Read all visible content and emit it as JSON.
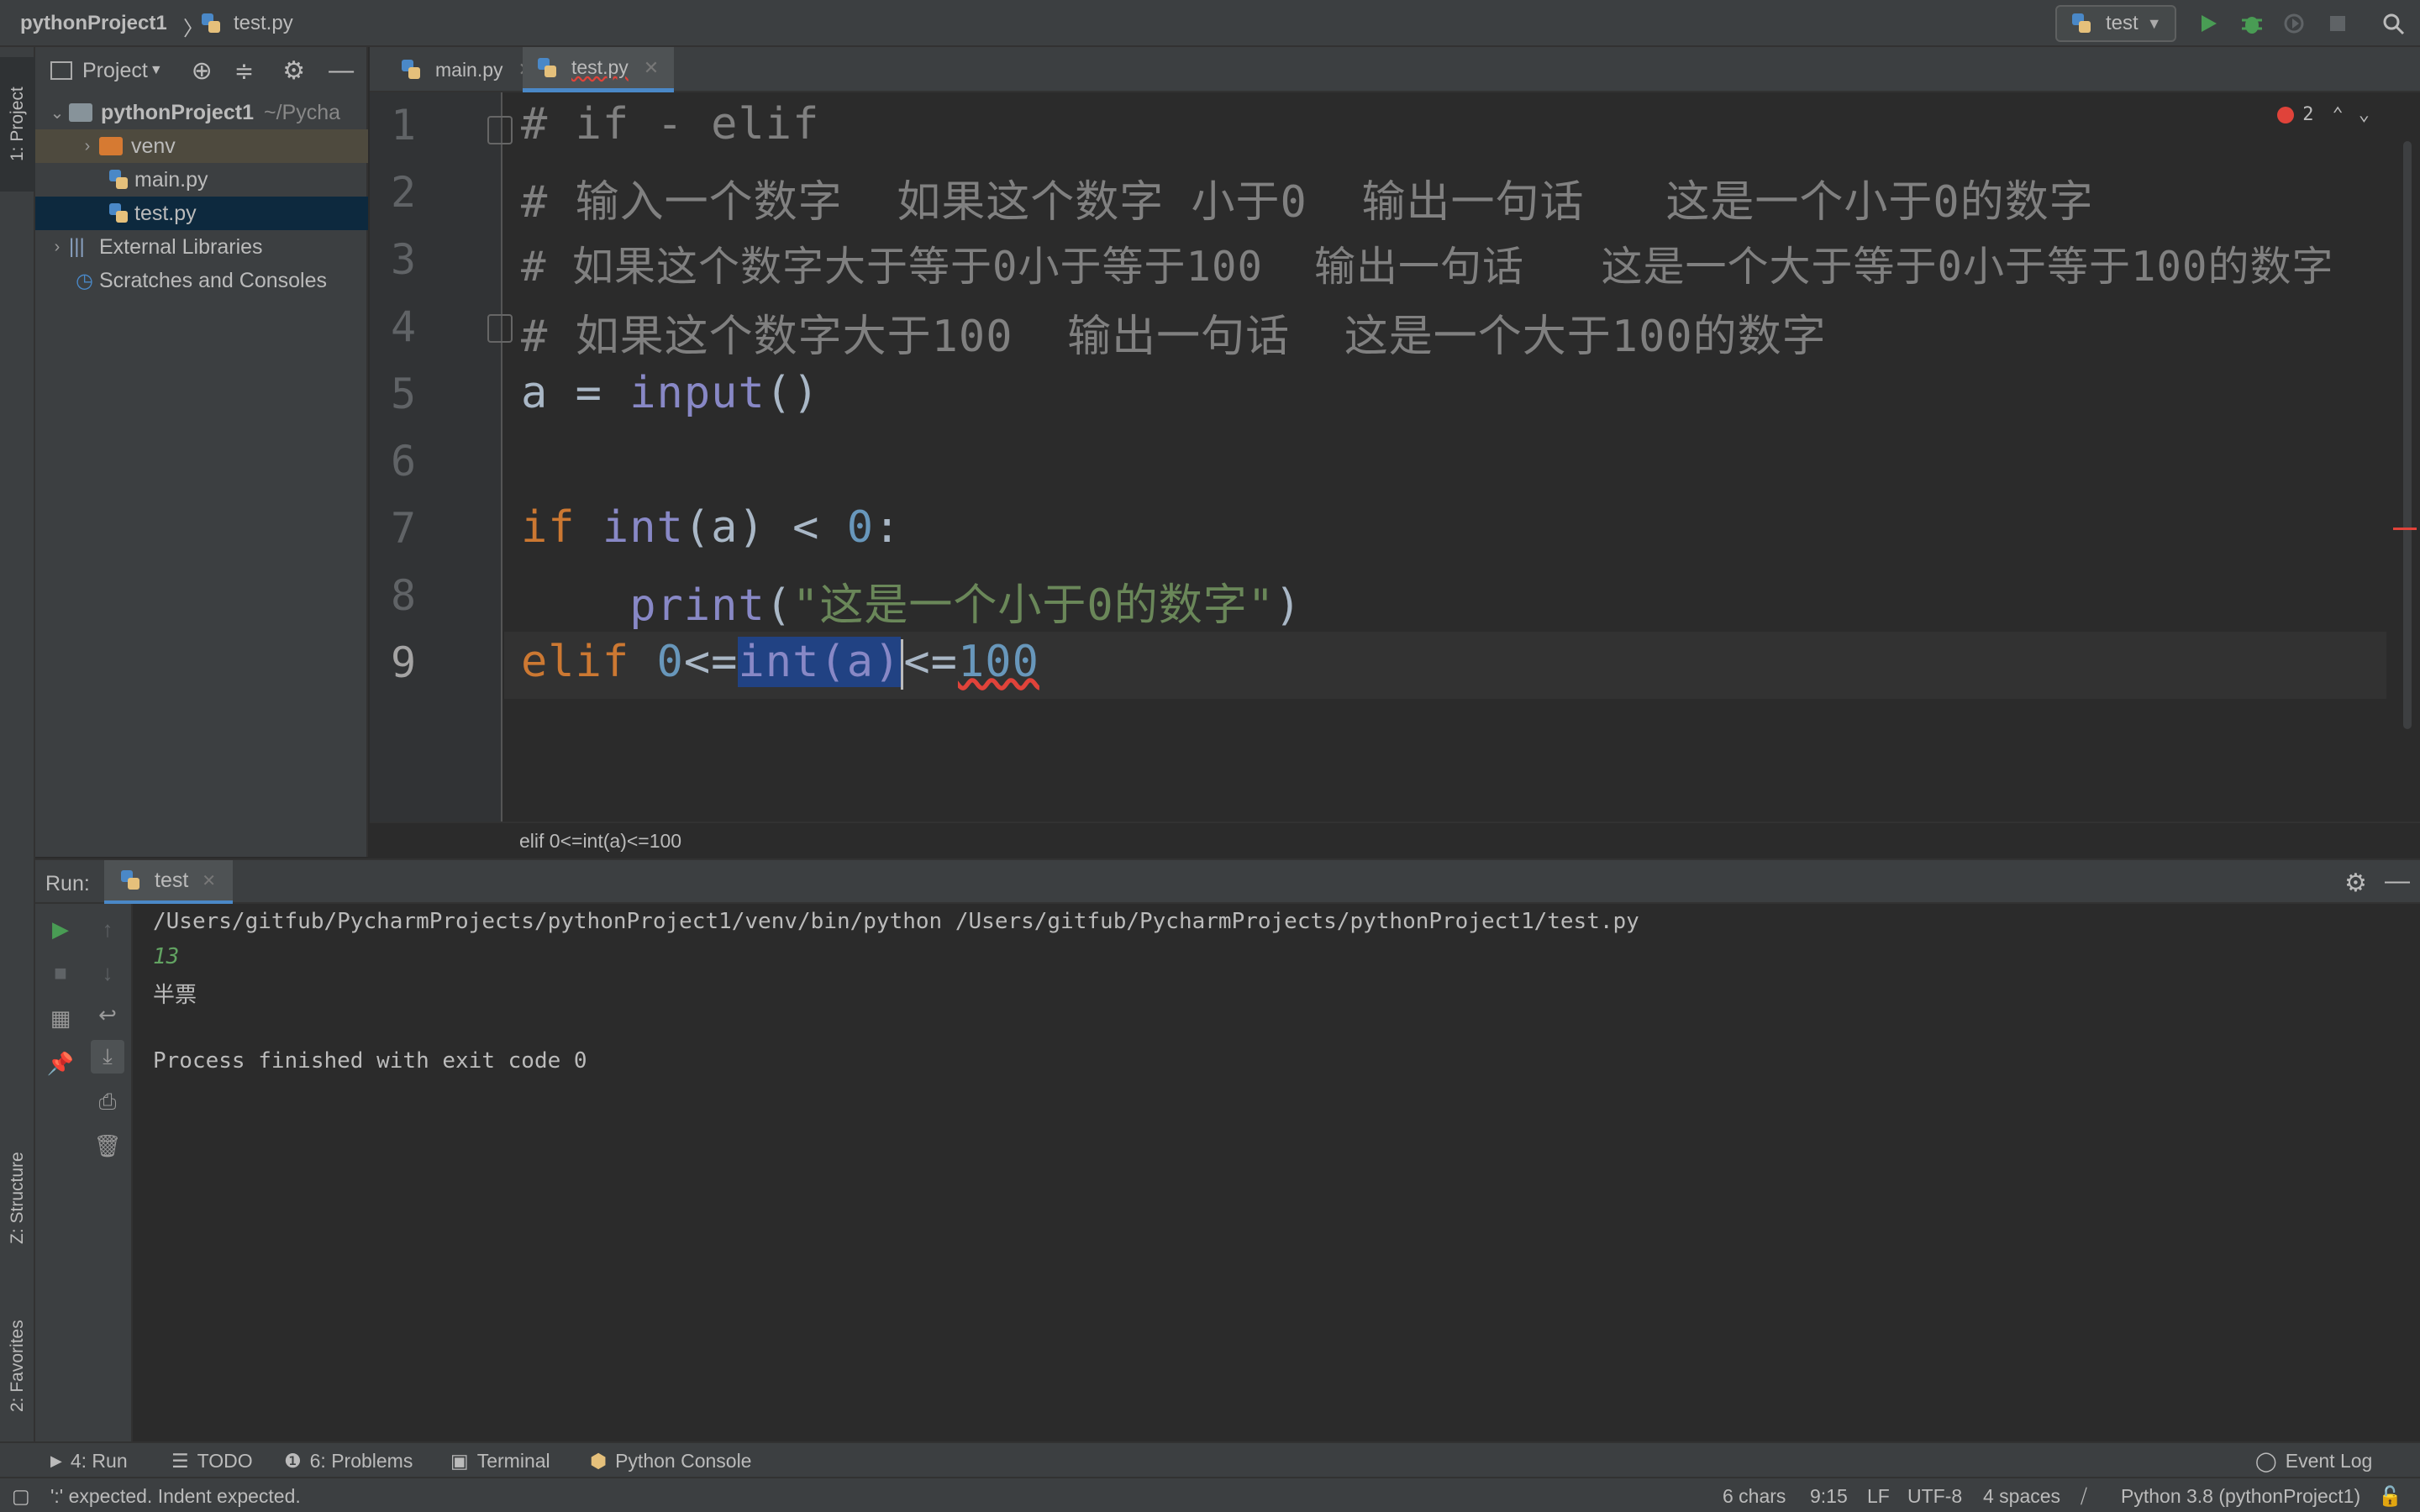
{
  "topbar": {
    "project_name": "pythonProject1",
    "separator": "〉",
    "file_name": "test.py",
    "run_config": "test"
  },
  "left_stripe": {
    "project_tab": "1: Project",
    "structure_tab": "Z: Structure",
    "favorites_tab": "2: Favorites"
  },
  "project_panel": {
    "title": "Project",
    "tree": [
      {
        "label": "pythonProject1",
        "suffix": "~/Pycha"
      },
      {
        "label": "venv"
      },
      {
        "label": "main.py"
      },
      {
        "label": "test.py"
      },
      {
        "label": "External Libraries"
      },
      {
        "label": "Scratches and Consoles"
      }
    ]
  },
  "editor": {
    "tabs": [
      {
        "label": "main.py"
      },
      {
        "label": "test.py"
      }
    ],
    "error_count": "2",
    "line_numbers": [
      "1",
      "2",
      "3",
      "4",
      "5",
      "6",
      "7",
      "8",
      "9"
    ],
    "lines": {
      "l1": "# if - elif",
      "l2": "# 输入一个数字  如果这个数字 小于0  输出一句话   这是一个小于0的数字",
      "l3": "# 如果这个数字大于等于0小于等于100  输出一句话   这是一个大于等于0小于等于100的数字",
      "l4": "# 如果这个数字大于100  输出一句话  这是一个大于100的数字",
      "l5_a": "a = ",
      "l5_fn": "input",
      "l5_p": "()",
      "l7_if": "if ",
      "l7_fn": "int",
      "l7_mid": "(a) < ",
      "l7_num": "0",
      "l7_end": ":",
      "l8_indent": "    ",
      "l8_fn": "print",
      "l8_open": "(",
      "l8_str": "\"这是一个小于0的数字\"",
      "l8_close": ")",
      "l9_kw": "elif ",
      "l9_num1": "0",
      "l9_op1": "<=",
      "l9_sel": "int(a)",
      "l9_op2": "<=",
      "l9_num2": "100"
    },
    "breadcrumb": "elif 0<=int(a)<=100"
  },
  "run": {
    "label": "Run:",
    "tab": "test",
    "console": {
      "command": "/Users/gitfub/PycharmProjects/pythonProject1/venv/bin/python /Users/gitfub/PycharmProjects/pythonProject1/test.py",
      "input": "13",
      "output": "半票",
      "exit": "Process finished with exit code 0"
    }
  },
  "tool_tabs": {
    "run": "4: Run",
    "todo": "TODO",
    "problems": "6: Problems",
    "terminal": "Terminal",
    "python_console": "Python Console",
    "event_log": "Event Log"
  },
  "status_bar": {
    "message": "':' expected. Indent expected.",
    "chars": "6 chars",
    "position": "9:15",
    "line_sep": "LF",
    "encoding": "UTF-8",
    "indent": "4 spaces",
    "interpreter": "Python 3.8 (pythonProject1)"
  },
  "colors": {
    "accent": "#4a88c7",
    "run_green": "#499c54",
    "error_red": "#e0433a",
    "keyword": "#cc7832",
    "string": "#6a8759",
    "number": "#6897bb"
  }
}
